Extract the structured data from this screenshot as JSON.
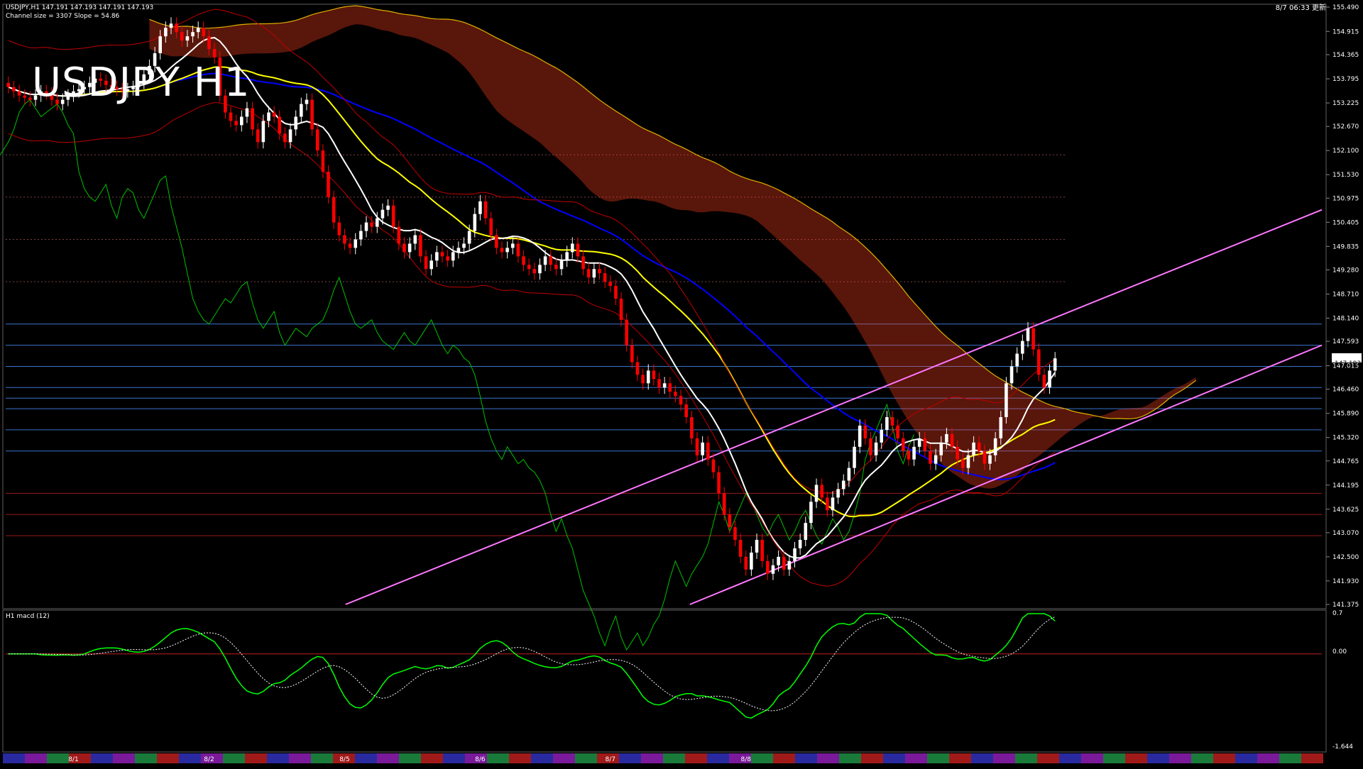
{
  "header": {
    "symbol_line": "USDJPY,H1  147.191 147.193 147.191 147.193",
    "channel_line": "Channel size = 3307 Slope = 54.86",
    "big_title": "USDJPY H1",
    "update_time": "8/7 06:33 更新"
  },
  "subwindow": {
    "title": "H1  macd (12)",
    "axis_top": "0.7",
    "axis_mid": "0.00",
    "axis_bottom": "-1.644"
  },
  "colors": {
    "background": "#000000",
    "bull_candle": "#ffffff",
    "bear_candle": "#ff0000",
    "ma_fast": "#ffffff",
    "ma_mid": "#ffff00",
    "ma_slow": "#0000ff",
    "chikou": "#00c000",
    "cloud": "#ff4020",
    "channel": "#ff77ff",
    "macd_pos": "#00ff00",
    "macd_neg": "#ff8888",
    "level_line": "#4a90ff"
  },
  "chart_data": {
    "type": "candlestick",
    "symbol": "USDJPY",
    "timeframe": "H1",
    "ylim": [
      141.375,
      155.49
    ],
    "y_ticks": [
      "155.490",
      "154.915",
      "154.365",
      "153.795",
      "153.225",
      "152.670",
      "152.100",
      "151.530",
      "150.975",
      "150.405",
      "149.835",
      "149.280",
      "148.710",
      "148.140",
      "147.593",
      "147.015",
      "146.460",
      "145.890",
      "145.320",
      "144.765",
      "144.195",
      "143.625",
      "143.070",
      "142.500",
      "141.930",
      "141.375"
    ],
    "current_price": "147.193",
    "x_labels": [
      {
        "label": "8/1",
        "i": 12
      },
      {
        "label": "8/2",
        "i": 37
      },
      {
        "label": "8/5",
        "i": 62
      },
      {
        "label": "8/6",
        "i": 87
      },
      {
        "label": "8/7",
        "i": 111
      },
      {
        "label": "8/8",
        "i": 136
      }
    ],
    "candles_count": 188,
    "close": [
      153.6,
      153.5,
      153.4,
      153.35,
      153.3,
      153.4,
      153.5,
      153.45,
      153.3,
      153.2,
      153.3,
      153.4,
      153.5,
      153.55,
      153.6,
      153.7,
      153.8,
      153.75,
      153.65,
      153.6,
      153.55,
      153.5,
      153.55,
      153.6,
      153.7,
      153.9,
      154.1,
      154.4,
      154.8,
      155.0,
      155.1,
      154.9,
      154.7,
      154.8,
      154.9,
      155.0,
      154.8,
      154.5,
      154.3,
      153.4,
      153.0,
      152.8,
      152.7,
      152.9,
      153.1,
      152.6,
      152.3,
      152.8,
      153.0,
      152.9,
      152.5,
      152.3,
      152.6,
      152.9,
      153.2,
      153.3,
      152.6,
      152.1,
      151.6,
      151.0,
      150.4,
      150.1,
      149.9,
      149.8,
      150.0,
      150.2,
      150.4,
      150.3,
      150.5,
      150.7,
      150.8,
      150.3,
      149.9,
      149.7,
      149.9,
      150.1,
      149.6,
      149.3,
      149.5,
      149.7,
      149.6,
      149.5,
      149.7,
      149.8,
      149.9,
      150.2,
      150.6,
      150.9,
      150.5,
      150.1,
      149.8,
      149.7,
      149.8,
      149.9,
      149.6,
      149.4,
      149.3,
      149.2,
      149.4,
      149.6,
      149.4,
      149.3,
      149.5,
      149.7,
      149.9,
      149.6,
      149.3,
      149.1,
      149.3,
      149.2,
      149.0,
      148.9,
      148.6,
      148.1,
      147.5,
      147.1,
      146.8,
      146.6,
      146.9,
      146.7,
      146.5,
      146.6,
      146.4,
      146.3,
      146.1,
      145.8,
      145.3,
      144.9,
      145.2,
      144.8,
      144.5,
      144.0,
      143.5,
      143.2,
      142.9,
      142.5,
      142.2,
      142.6,
      142.9,
      142.4,
      142.1,
      142.3,
      142.5,
      142.2,
      142.4,
      142.7,
      142.9,
      143.3,
      143.8,
      144.2,
      143.9,
      143.6,
      143.9,
      144.1,
      144.3,
      144.6,
      145.1,
      145.6,
      145.3,
      144.9,
      145.2,
      145.5,
      145.8,
      145.6,
      145.3,
      145.0,
      144.8,
      145.1,
      145.3,
      145.0,
      144.7,
      144.9,
      145.2,
      145.4,
      145.1,
      144.8,
      144.6,
      144.9,
      145.2,
      145.0,
      144.7,
      144.9,
      145.3,
      145.8,
      146.6,
      147.0,
      147.3,
      147.6,
      147.9,
      147.4,
      146.8,
      146.5,
      146.9,
      147.19
    ]
  }
}
